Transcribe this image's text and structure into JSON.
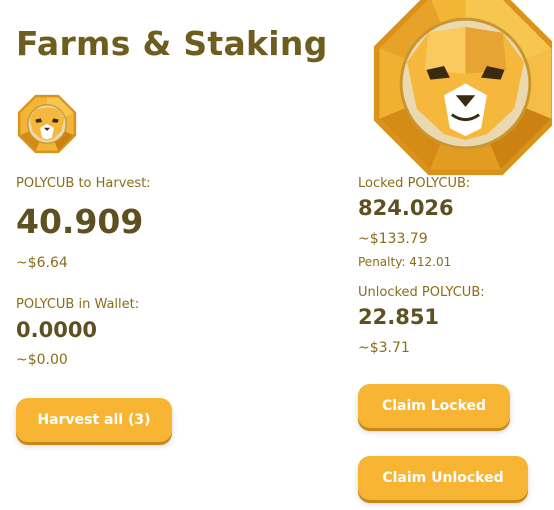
{
  "page": {
    "title": "Farms & Staking"
  },
  "colors": {
    "accent": "#f8b534",
    "title": "#6e5d1e",
    "label": "#8a6d18"
  },
  "icons": {
    "small_logo": "polycub-lion-icon",
    "big_logo": "polycub-lion-icon"
  },
  "harvest": {
    "label": "POLYCUB to Harvest:",
    "amount": "40.909",
    "usd": "~$6.64"
  },
  "wallet": {
    "label": "POLYCUB in Wallet:",
    "amount": "0.0000",
    "usd": "~$0.00"
  },
  "locked": {
    "label": "Locked POLYCUB:",
    "amount": "824.026",
    "usd": "~$133.79",
    "penalty": "Penalty: 412.01"
  },
  "unlocked": {
    "label": "Unlocked POLYCUB:",
    "amount": "22.851",
    "usd": "~$3.71"
  },
  "buttons": {
    "harvest_all": "Harvest all (3)",
    "claim_locked": "Claim Locked",
    "claim_unlocked": "Claim Unlocked"
  }
}
